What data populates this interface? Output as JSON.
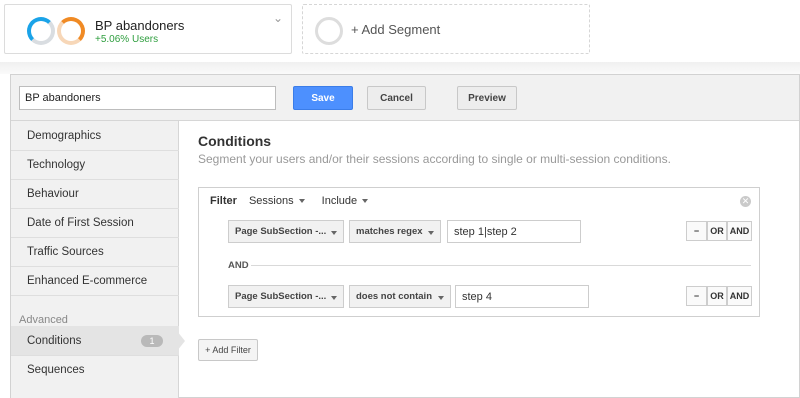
{
  "segment_bar": {
    "segment": {
      "name": "BP abandoners",
      "users_change": "+5.06% Users"
    },
    "add_segment_label": "+ Add Segment"
  },
  "editor": {
    "segment_name_value": "BP abandoners",
    "save_label": "Save",
    "cancel_label": "Cancel",
    "preview_label": "Preview"
  },
  "sidebar": {
    "items": [
      {
        "label": "Demographics"
      },
      {
        "label": "Technology"
      },
      {
        "label": "Behaviour"
      },
      {
        "label": "Date of First Session"
      },
      {
        "label": "Traffic Sources"
      },
      {
        "label": "Enhanced E-commerce"
      }
    ],
    "advanced_label": "Advanced",
    "advanced_items": [
      {
        "label": "Conditions",
        "badge": "1"
      },
      {
        "label": "Sequences"
      }
    ]
  },
  "main": {
    "title": "Conditions",
    "subtitle": "Segment your users and/or their sessions according to single or multi-session conditions.",
    "filter": {
      "label": "Filter",
      "scope": "Sessions",
      "mode": "Include",
      "and_separator": "AND",
      "conditions": [
        {
          "dimension": "Page SubSection -...",
          "operator": "matches regex",
          "value": "step 1|step 2",
          "minus": "−",
          "or": "OR",
          "and": "AND"
        },
        {
          "dimension": "Page SubSection -...",
          "operator": "does not contain",
          "value": "step 4",
          "minus": "−",
          "or": "OR",
          "and": "AND"
        }
      ]
    },
    "add_filter_label": "+ Add Filter"
  }
}
